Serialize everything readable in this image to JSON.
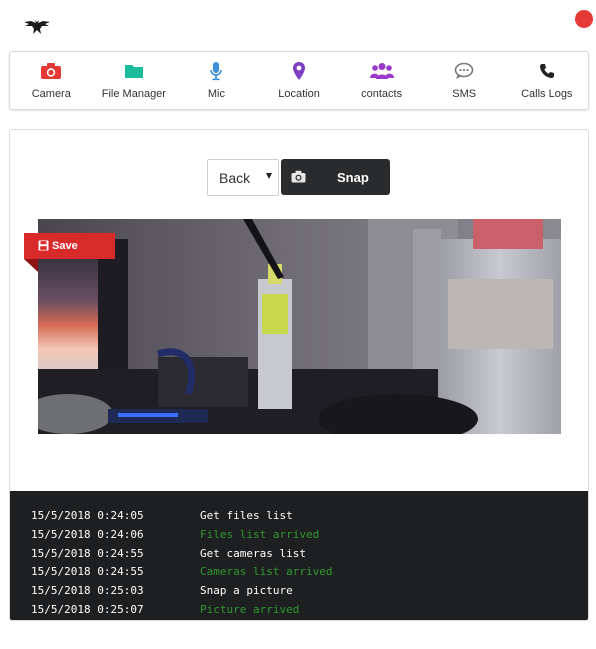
{
  "header": {
    "status_color": "#e53935"
  },
  "nav": [
    {
      "label": "Camera",
      "icon": "camera-icon",
      "color": "#e53935"
    },
    {
      "label": "File Manager",
      "icon": "folder-icon",
      "color": "#1bbc9b"
    },
    {
      "label": "Mic",
      "icon": "microphone-icon",
      "color": "#3b8fd6"
    },
    {
      "label": "Location",
      "icon": "map-marker-icon",
      "color": "#7b3fbf"
    },
    {
      "label": "contacts",
      "icon": "users-icon",
      "color": "#9b37c9"
    },
    {
      "label": "SMS",
      "icon": "chat-bubble-icon",
      "color": "#7a7a7a"
    },
    {
      "label": "Calls Logs",
      "icon": "phone-icon",
      "color": "#222222"
    }
  ],
  "camera": {
    "select_value": "Back",
    "snap_label": "Snap",
    "save_label": "Save"
  },
  "console": {
    "lines": [
      {
        "time": "15/5/2018 0:24:05",
        "msg": "Get files list",
        "kind": "req"
      },
      {
        "time": "15/5/2018 0:24:06",
        "msg": "Files list arrived",
        "kind": "res"
      },
      {
        "time": "15/5/2018 0:24:55",
        "msg": "Get cameras list",
        "kind": "req"
      },
      {
        "time": "15/5/2018 0:24:55",
        "msg": "Cameras list arrived",
        "kind": "res"
      },
      {
        "time": "15/5/2018 0:25:03",
        "msg": "Snap a picture",
        "kind": "req"
      },
      {
        "time": "15/5/2018 0:25:07",
        "msg": "Picture arrived",
        "kind": "res"
      }
    ]
  }
}
